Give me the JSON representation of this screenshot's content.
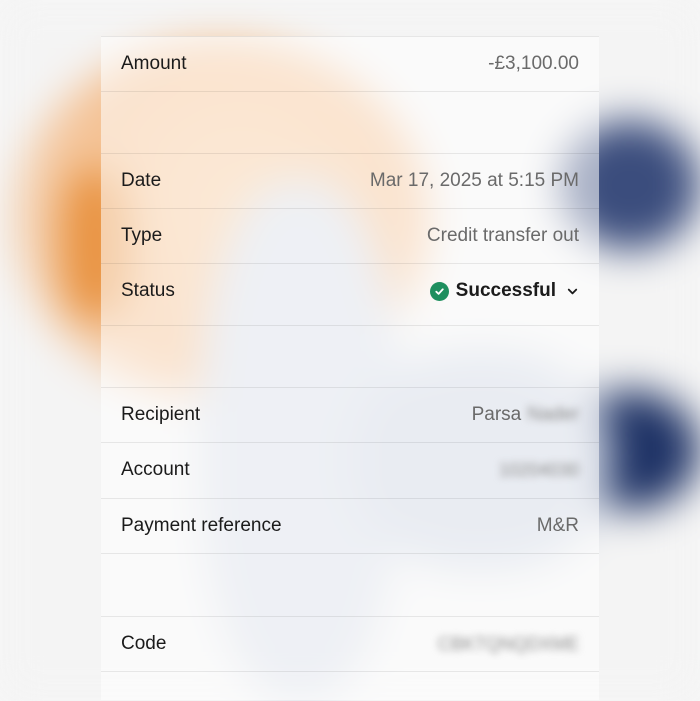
{
  "details": {
    "amount": {
      "label": "Amount",
      "value": "-£3,100.00"
    },
    "date": {
      "label": "Date",
      "value": "Mar 17, 2025 at 5:15 PM"
    },
    "type": {
      "label": "Type",
      "value": "Credit transfer out"
    },
    "status": {
      "label": "Status",
      "value": "Successful"
    },
    "recipient": {
      "label": "Recipient",
      "value": "Parsa",
      "value_redacted": "Nader"
    },
    "account": {
      "label": "Account",
      "value_redacted": "10204030"
    },
    "payment_reference": {
      "label": "Payment reference",
      "value": "M&R"
    },
    "code": {
      "label": "Code",
      "value_redacted": "CBKTQNQDXME"
    }
  },
  "colors": {
    "status_green": "#1e8f5e",
    "accent_orange": "#f4c193",
    "accent_navy": "#1f3366"
  },
  "icons": {
    "status": "check-circle-icon",
    "expand": "chevron-down-icon"
  }
}
